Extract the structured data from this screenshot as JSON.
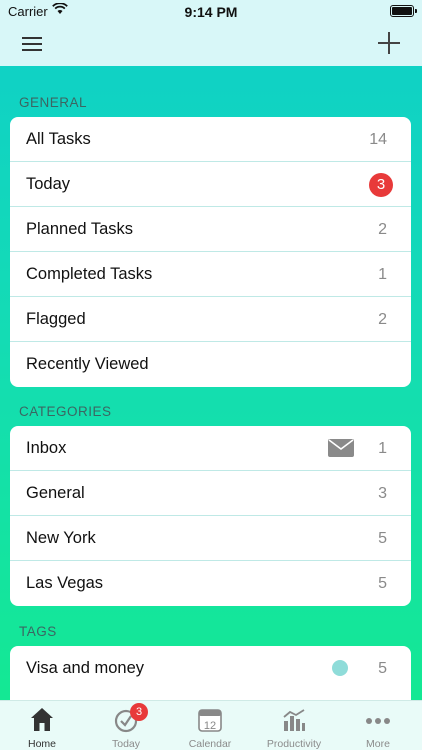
{
  "status_bar": {
    "carrier": "Carrier",
    "time": "9:14 PM"
  },
  "sections": {
    "general": {
      "title": "GENERAL",
      "items": [
        {
          "label": "All Tasks",
          "count": "14"
        },
        {
          "label": "Today",
          "badge": "3"
        },
        {
          "label": "Planned Tasks",
          "count": "2"
        },
        {
          "label": "Completed Tasks",
          "count": "1"
        },
        {
          "label": "Flagged",
          "count": "2"
        },
        {
          "label": "Recently Viewed"
        }
      ]
    },
    "categories": {
      "title": "CATEGORIES",
      "items": [
        {
          "label": "Inbox",
          "count": "1",
          "icon": "mail-icon"
        },
        {
          "label": "General",
          "count": "3"
        },
        {
          "label": "New York",
          "count": "5"
        },
        {
          "label": "Las Vegas",
          "count": "5"
        }
      ]
    },
    "tags": {
      "title": "TAGS",
      "items": [
        {
          "label": "Visa and money",
          "count": "5",
          "color": "#8fdcd9"
        }
      ]
    }
  },
  "tab_bar": {
    "items": [
      {
        "label": "Home",
        "icon": "home-icon",
        "active": true
      },
      {
        "label": "Today",
        "icon": "today-check-icon",
        "badge": "3"
      },
      {
        "label": "Calendar",
        "icon": "calendar-icon",
        "day": "12"
      },
      {
        "label": "Productivity",
        "icon": "productivity-icon"
      },
      {
        "label": "More",
        "icon": "more-dots-icon"
      }
    ]
  },
  "colors": {
    "accent": "#14dcb4",
    "badge": "#e83a3a"
  }
}
